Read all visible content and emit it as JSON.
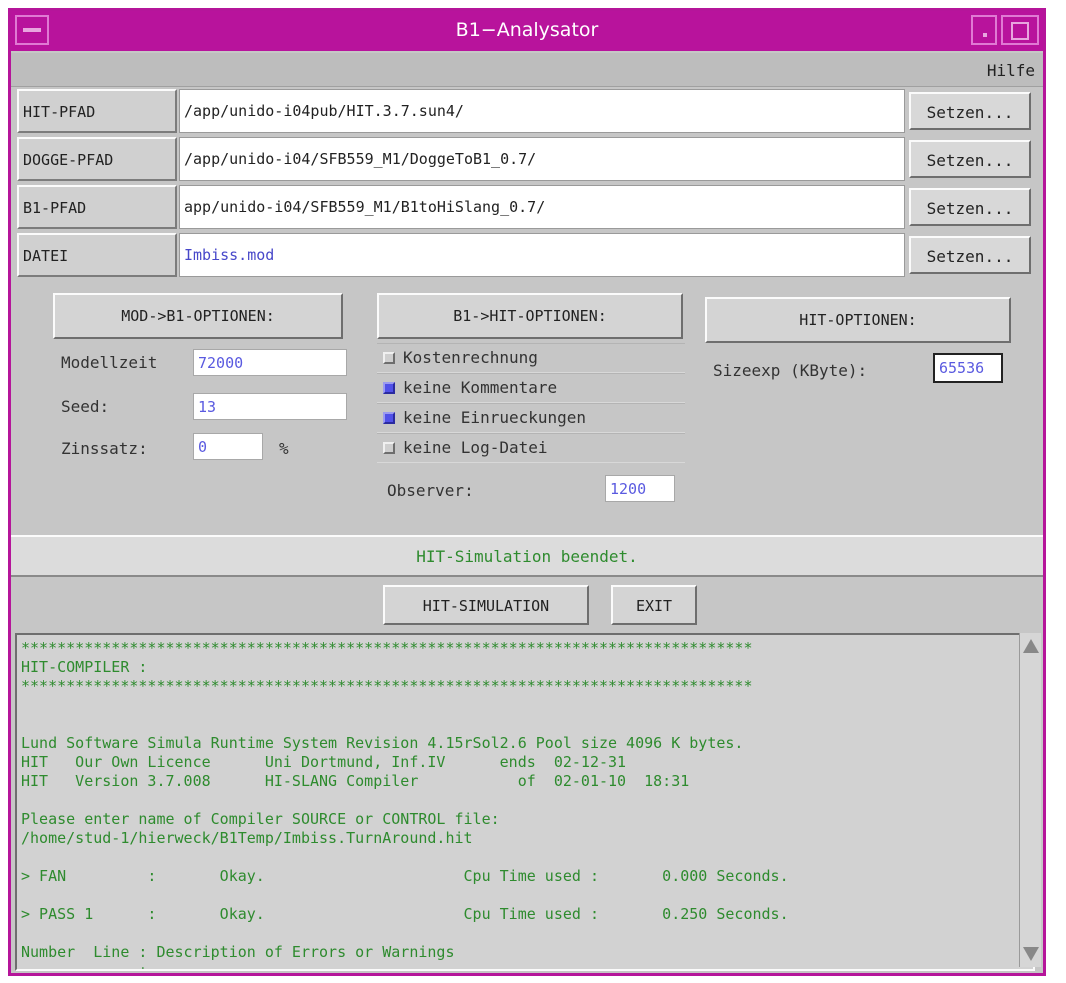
{
  "window": {
    "title": "B1−Analysator"
  },
  "menu": {
    "help": "Hilfe"
  },
  "paths": [
    {
      "label": "HIT-PFAD",
      "value": "/app/unido-i04pub/HIT.3.7.sun4/",
      "button": "Setzen..."
    },
    {
      "label": "DOGGE-PFAD",
      "value": "/app/unido-i04/SFB559_M1/DoggeToB1_0.7/",
      "button": "Setzen..."
    },
    {
      "label": "B1-PFAD",
      "value": "app/unido-i04/SFB559_M1/B1toHiSlang_0.7/",
      "button": "Setzen..."
    },
    {
      "label": "DATEI",
      "value": "Imbiss.mod",
      "button": "Setzen..."
    }
  ],
  "mod_options": {
    "button": "MOD->B1-OPTIONEN:",
    "modellzeit_label": "Modellzeit",
    "modellzeit_value": "72000",
    "seed_label": "Seed:",
    "seed_value": "13",
    "zinssatz_label": "Zinssatz:",
    "zinssatz_value": "0",
    "zinssatz_unit": "%"
  },
  "b1_options": {
    "button": "B1->HIT-OPTIONEN:",
    "checkboxes": [
      {
        "label": "Kostenrechnung",
        "checked": false
      },
      {
        "label": "keine Kommentare",
        "checked": true
      },
      {
        "label": "keine Einrueckungen",
        "checked": true
      },
      {
        "label": "keine Log-Datei",
        "checked": false
      }
    ],
    "observer_label": "Observer:",
    "observer_value": "1200"
  },
  "hit_options": {
    "button": "HIT-OPTIONEN:",
    "sizeexp_label": "Sizeexp (KByte):",
    "sizeexp_value": "65536"
  },
  "status": "HIT-Simulation beendet.",
  "actions": {
    "simulate": "HIT-SIMULATION",
    "exit": "EXIT"
  },
  "log_lines": [
    "*********************************************************************************",
    "HIT-COMPILER :",
    "*********************************************************************************",
    "",
    "",
    "Lund Software Simula Runtime System Revision 4.15rSol2.6 Pool size 4096 K bytes.",
    "HIT   Our Own Licence      Uni Dortmund, Inf.IV      ends  02-12-31",
    "HIT   Version 3.7.008      HI-SLANG Compiler           of  02-01-10  18:31",
    "",
    "Please enter name of Compiler SOURCE or CONTROL file:",
    "/home/stud-1/hierweck/B1Temp/Imbiss.TurnAround.hit",
    "",
    "> FAN         :       Okay.                      Cpu Time used :       0.000 Seconds.",
    "",
    "> PASS 1      :       Okay.                      Cpu Time used :       0.250 Seconds.",
    "",
    "Number  Line : Description of Errors or Warnings",
    "-------------+-----------------------------------------------------------------"
  ],
  "colors": {
    "title_bar": "#b8139c",
    "log_text": "#2e8b2e",
    "field_text": "#5a5ae0",
    "checkbox_on": "#5050e8"
  }
}
